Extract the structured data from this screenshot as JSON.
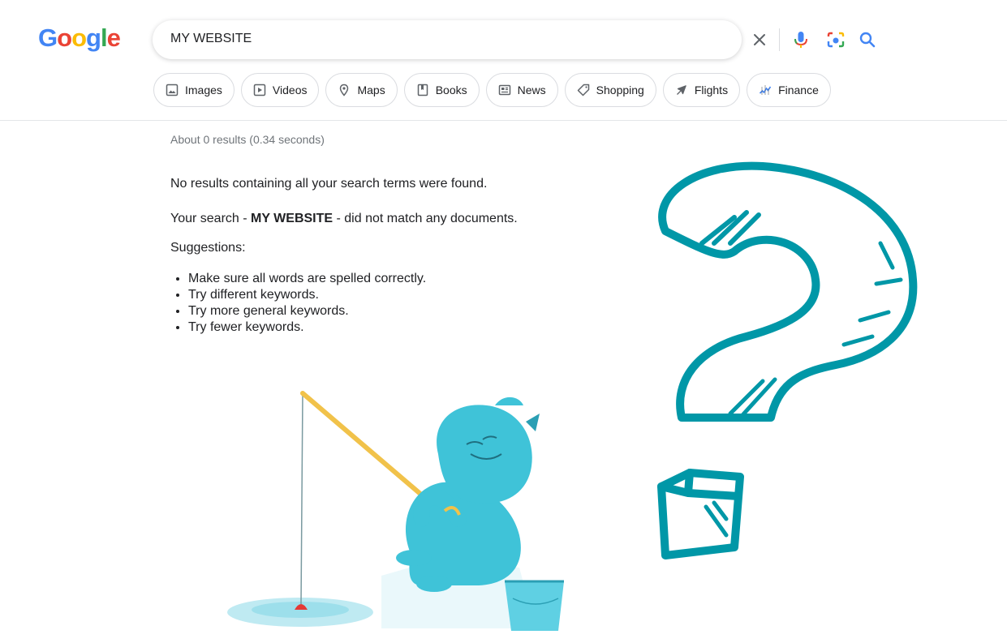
{
  "logo": {
    "text": "Google"
  },
  "search": {
    "query": "MY WEBSITE"
  },
  "chips": [
    {
      "label": "Images",
      "icon": "image-icon"
    },
    {
      "label": "Videos",
      "icon": "play-icon"
    },
    {
      "label": "Maps",
      "icon": "map-pin-icon"
    },
    {
      "label": "Books",
      "icon": "book-icon"
    },
    {
      "label": "News",
      "icon": "news-icon"
    },
    {
      "label": "Shopping",
      "icon": "tag-icon"
    },
    {
      "label": "Flights",
      "icon": "plane-icon"
    },
    {
      "label": "Finance",
      "icon": "finance-icon"
    }
  ],
  "results": {
    "stats": "About 0 results (0.34 seconds)",
    "no_results": "No results containing all your search terms were found.",
    "did_not_match_prefix": "Your search - ",
    "did_not_match_query": "MY WEBSITE",
    "did_not_match_suffix": " - did not match any documents.",
    "suggestions_title": "Suggestions:",
    "suggestions": [
      "Make sure all words are spelled correctly.",
      "Try different keywords.",
      "Try more general keywords.",
      "Try fewer keywords."
    ]
  },
  "colors": {
    "question_mark": "#0097a7",
    "yeti": "#3fc3d8",
    "rod": "#f1c24a",
    "google_blue": "#4285F4",
    "google_red": "#EA4335",
    "google_yellow": "#FBBC05",
    "google_green": "#34A853"
  }
}
